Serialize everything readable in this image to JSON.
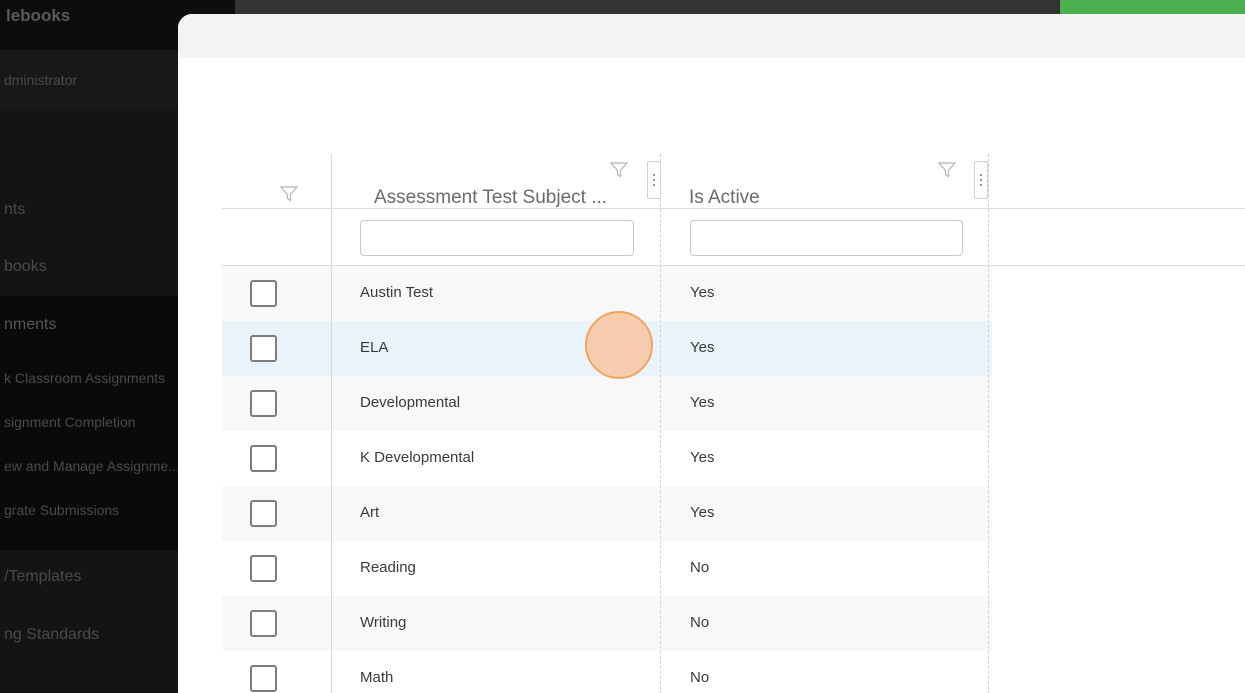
{
  "sidebar": {
    "title": "lebooks",
    "items": [
      {
        "label": "dministrator"
      },
      {
        "label": "nts"
      },
      {
        "label": "books"
      },
      {
        "label": "nments"
      },
      {
        "label": "k Classroom Assignments"
      },
      {
        "label": "signment Completion"
      },
      {
        "label": "ew and Manage Assignme..."
      },
      {
        "label": "grate Submissions"
      },
      {
        "label": "/Templates"
      },
      {
        "label": "ng Standards"
      }
    ]
  },
  "grid": {
    "columns": [
      {
        "label": "Assessment Test Subject ...",
        "filter_value": ""
      },
      {
        "label": "Is Active",
        "filter_value": ""
      }
    ],
    "rows": [
      {
        "subject": "Austin Test",
        "active": "Yes"
      },
      {
        "subject": "ELA",
        "active": "Yes"
      },
      {
        "subject": "Developmental",
        "active": "Yes"
      },
      {
        "subject": "K Developmental",
        "active": "Yes"
      },
      {
        "subject": "Art",
        "active": "Yes"
      },
      {
        "subject": "Reading",
        "active": "No"
      },
      {
        "subject": "Writing",
        "active": "No"
      },
      {
        "subject": "Math",
        "active": "No"
      }
    ],
    "hovered_row": "ELA"
  },
  "icons": {
    "filter": "filter-icon",
    "column_menu": "more-vertical-icon"
  },
  "colors": {
    "accent_green": "#4cae4f",
    "row_highlight": "#e9f3fc",
    "click_marker": "#f2a65a"
  }
}
